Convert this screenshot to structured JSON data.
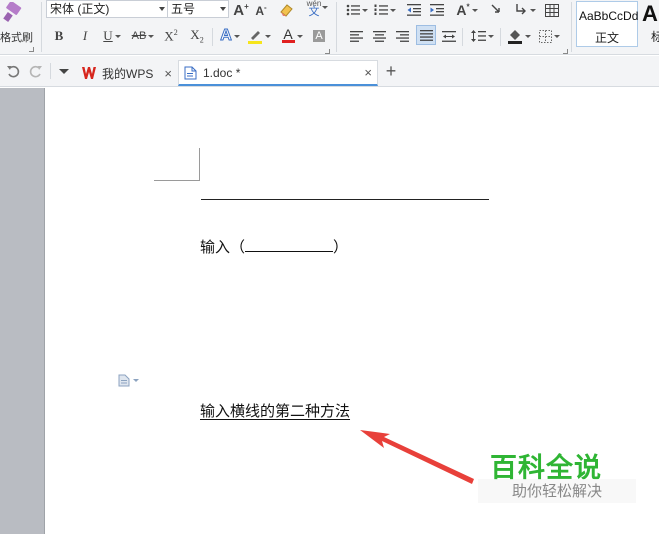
{
  "ribbon": {
    "format_painter_label": "格式刷",
    "font_name": "宋体 (正文)",
    "font_size": "五号",
    "pinyin_glyph": "wén",
    "pinyin_char": "文",
    "bold": "B",
    "italic": "I",
    "underline": "U",
    "strikethrough": "AB",
    "superscript_base": "X",
    "superscript_exp": "2",
    "subscript_base": "X",
    "subscript_sub": "2",
    "font_color_glyph": "A",
    "char_shading_glyph": "A",
    "grow_font_glyph": "A",
    "shrink_font_glyph": "A",
    "text_effect_glyph": "A",
    "styles": [
      {
        "sample": "AaBbCcDd",
        "name": "正文"
      },
      {
        "sample": "A",
        "name": "标"
      }
    ]
  },
  "tabs": [
    {
      "label": "我的WPS",
      "active": false
    },
    {
      "label": "1.doc *",
      "active": true
    }
  ],
  "document": {
    "line1_paren_open": "输入（",
    "line1_paren_close": "）",
    "heading": "输入横线的第二种方法"
  },
  "watermark": {
    "title": "百科全说",
    "subtitle": "助你轻松解决"
  },
  "colors": {
    "arrow": "#e8403a",
    "watermark_green": "#2fb534",
    "wps_red": "#d7261e",
    "tab_accent": "#4a90d9"
  }
}
